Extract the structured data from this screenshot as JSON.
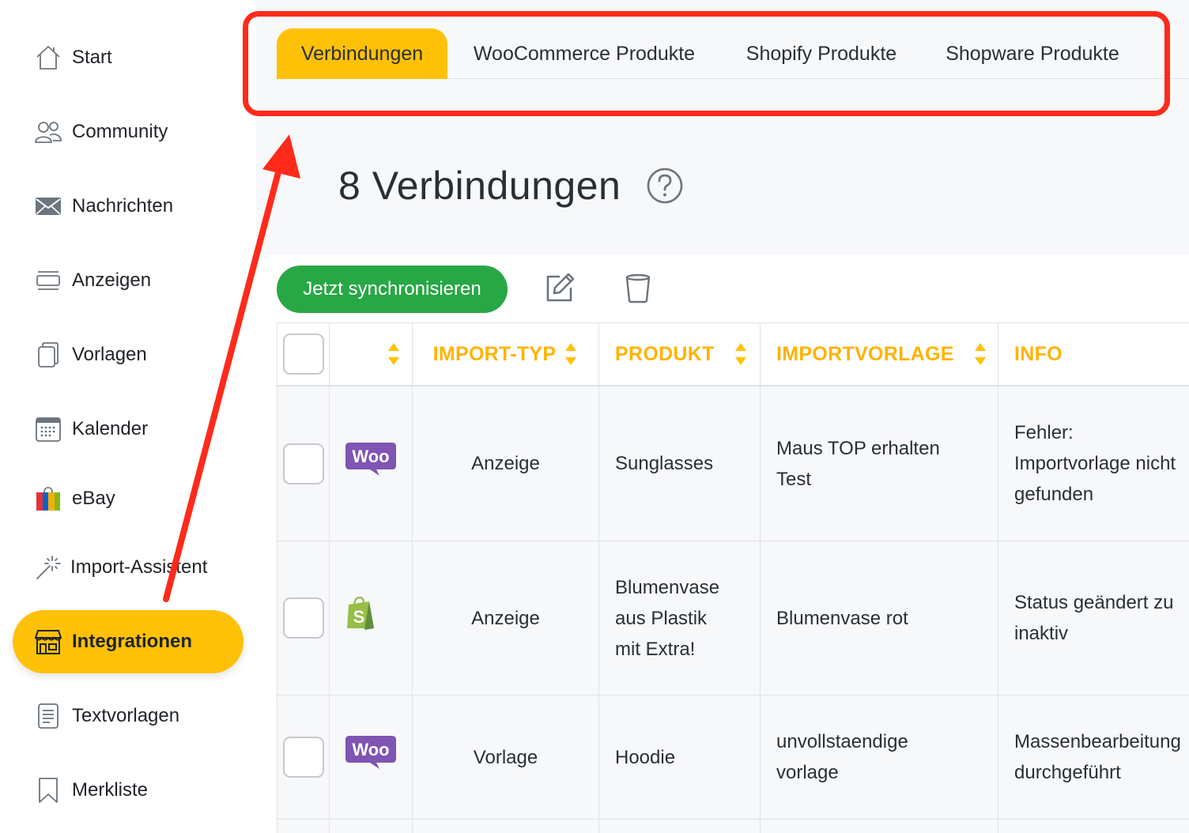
{
  "sidebar": {
    "items": [
      {
        "label": "Start",
        "icon": "home-icon"
      },
      {
        "label": "Community",
        "icon": "users-icon"
      },
      {
        "label": "Nachrichten",
        "icon": "envelope-icon"
      },
      {
        "label": "Anzeigen",
        "icon": "ads-icon"
      },
      {
        "label": "Vorlagen",
        "icon": "copy-icon"
      },
      {
        "label": "Kalender",
        "icon": "calendar-icon"
      },
      {
        "label": "eBay",
        "icon": "ebay-bag-icon"
      },
      {
        "label": "Import-Assistent",
        "icon": "magic-wand-icon"
      },
      {
        "label": "Integrationen",
        "icon": "store-icon",
        "active": true
      },
      {
        "label": "Textvorlagen",
        "icon": "document-icon"
      },
      {
        "label": "Merkliste",
        "icon": "bookmark-icon"
      }
    ]
  },
  "tabs": [
    {
      "label": "Verbindungen",
      "active": true
    },
    {
      "label": "WooCommerce Produkte"
    },
    {
      "label": "Shopify Produkte"
    },
    {
      "label": "Shopware Produkte"
    }
  ],
  "page": {
    "title": "8 Verbindungen"
  },
  "toolbar": {
    "sync_label": "Jetzt synchronisieren"
  },
  "table": {
    "headers": {
      "import_type": "IMPORT-TYP",
      "product": "PRODUKT",
      "template": "IMPORTVORLAGE",
      "info": "INFO"
    },
    "rows": [
      {
        "platform": "WooCommerce",
        "logo_text": "Woo",
        "import_type": "Anzeige",
        "product": "Sunglasses",
        "template_lines": [
          "Maus TOP erhalten",
          "Test"
        ],
        "info_lines": [
          "Fehler:",
          "Importvorlage nicht",
          "gefunden"
        ]
      },
      {
        "platform": "Shopify",
        "logo_text": "S",
        "import_type": "Anzeige",
        "product_lines": [
          "Blumenvase",
          "aus Plastik",
          "mit Extra!"
        ],
        "template": "Blumenvase rot",
        "info_lines": [
          "Status geändert zu",
          "inaktiv"
        ]
      },
      {
        "platform": "WooCommerce",
        "logo_text": "Woo",
        "import_type": "Vorlage",
        "product": "Hoodie",
        "template_lines": [
          "unvollstaendige",
          "vorlage"
        ],
        "info_lines": [
          "Massenbearbeitung",
          "durchgeführt"
        ]
      }
    ]
  },
  "colors": {
    "accent": "#ffc107",
    "header_text": "#ffb300",
    "sync_button": "#28a745",
    "annotation": "#ff2a1a",
    "woo_purple": "#7f54b3",
    "shopify_green": "#95bf47"
  }
}
